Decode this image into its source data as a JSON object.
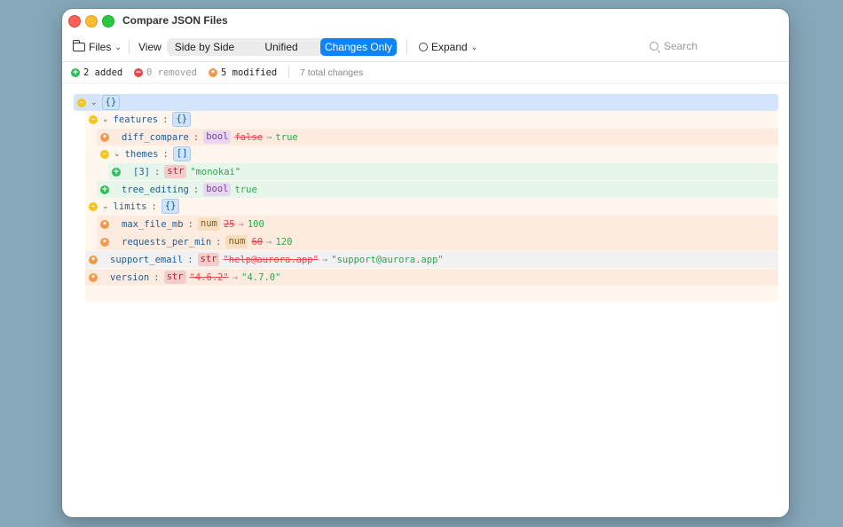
{
  "window": {
    "title": "Compare JSON Files"
  },
  "toolbar": {
    "files_label": "Files",
    "view_label": "View",
    "view_modes": [
      "Side by Side",
      "Unified",
      "Changes Only"
    ],
    "active_mode": "Changes Only",
    "expand_label": "Expand",
    "search_placeholder": "Search"
  },
  "stats": {
    "added": "2 added",
    "removed": "0 removed",
    "modified": "5 modified",
    "total": "7 total changes"
  },
  "tree": {
    "root": {
      "badge": "{}"
    },
    "features": {
      "key": "features",
      "badge": "{}"
    },
    "diff_compare": {
      "key": "diff_compare",
      "type": "bool",
      "old": "false",
      "new": "true"
    },
    "themes": {
      "key": "themes",
      "badge": "[]"
    },
    "themes_3": {
      "key": "[3]",
      "type": "str",
      "new": "\"monokai\""
    },
    "tree_editing": {
      "key": "tree_editing",
      "type": "bool",
      "new": "true"
    },
    "limits": {
      "key": "limits",
      "badge": "{}"
    },
    "max_file_mb": {
      "key": "max_file_mb",
      "type": "num",
      "old": "25",
      "new": "100"
    },
    "requests_per_min": {
      "key": "requests_per_min",
      "type": "num",
      "old": "60",
      "new": "120"
    },
    "support_email": {
      "key": "support_email",
      "type": "str",
      "old": "\"help@aurora.app\"",
      "new": "\"support@aurora.app\""
    },
    "version": {
      "key": "version",
      "type": "str",
      "old": "\"4.6.2\"",
      "new": "\"4.7.0\""
    },
    "colon": ":",
    "arrow": "→"
  },
  "colors": {
    "accent": "#0a84ff",
    "added_bg": "#e6f6ea",
    "modified_bg": "#fdefe6",
    "container_bg": "#fff6ee",
    "root_bg": "#d3e4fb"
  }
}
